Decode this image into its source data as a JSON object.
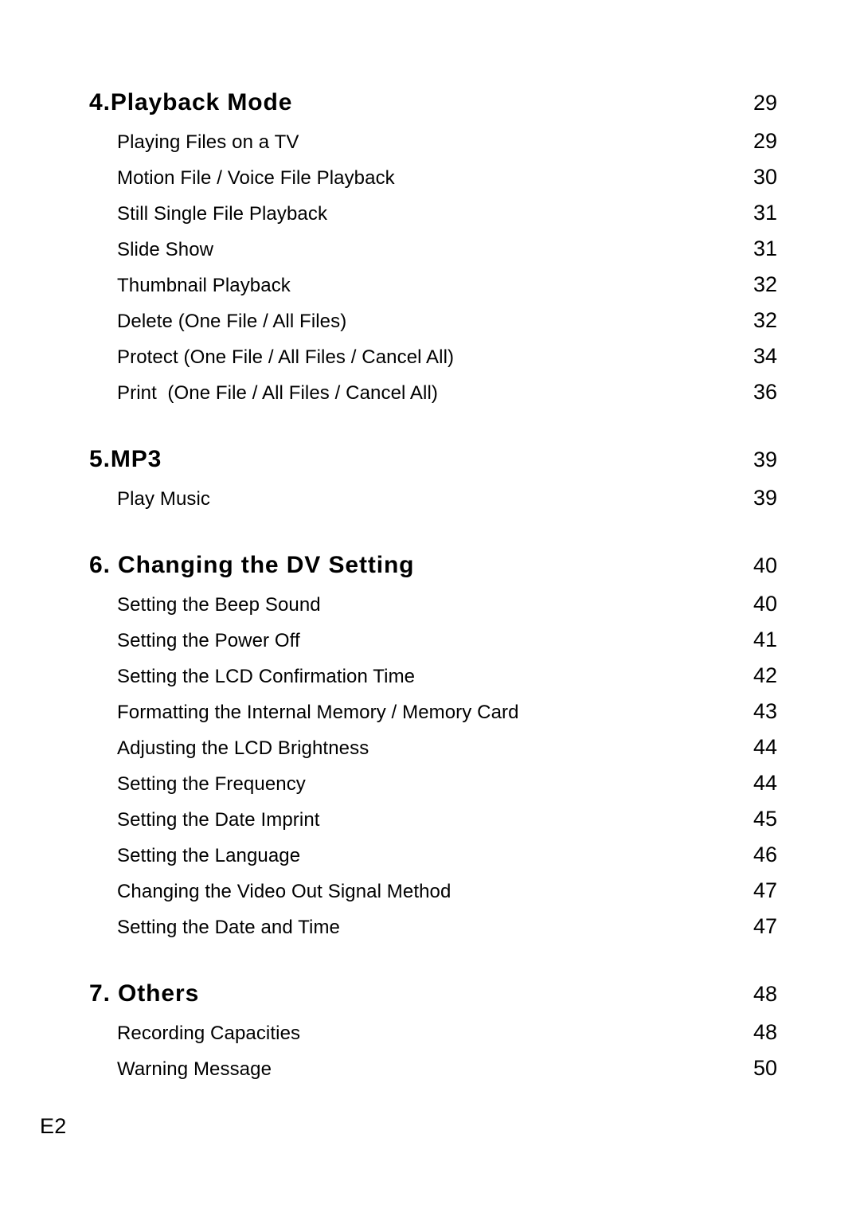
{
  "document": {
    "type": "table-of-contents",
    "footer_label": "E2",
    "page_number_column_label": ""
  },
  "sections": [
    {
      "heading": "4.Playback Mode",
      "heading_page": "29",
      "entries": [
        {
          "title": "Playing Files on a TV",
          "page": "29"
        },
        {
          "title": "Motion File / Voice File Playback",
          "page": "30"
        },
        {
          "title": "Still Single File Playback",
          "page": "31"
        },
        {
          "title": "Slide Show",
          "page": "31"
        },
        {
          "title": "Thumbnail Playback",
          "page": "32"
        },
        {
          "title": "Delete (One File / All Files)",
          "page": "32"
        },
        {
          "title": "Protect (One File / All Files / Cancel All)",
          "page": "34"
        },
        {
          "title": "Print  (One File / All Files / Cancel All)",
          "page": "36"
        }
      ]
    },
    {
      "heading": "5.MP3",
      "heading_page": "39",
      "entries": [
        {
          "title": "Play Music",
          "page": "39"
        }
      ]
    },
    {
      "heading": "6. Changing the DV Setting",
      "heading_page": "40",
      "entries": [
        {
          "title": "Setting the Beep Sound",
          "page": "40"
        },
        {
          "title": "Setting the Power Off",
          "page": "41"
        },
        {
          "title": "Setting the LCD Confirmation Time",
          "page": "42"
        },
        {
          "title": "Formatting the Internal Memory / Memory Card",
          "page": "43"
        },
        {
          "title": "Adjusting the LCD Brightness",
          "page": "44"
        },
        {
          "title": "Setting the Frequency",
          "page": "44"
        },
        {
          "title": "Setting the Date Imprint",
          "page": "45"
        },
        {
          "title": "Setting the Language",
          "page": "46"
        },
        {
          "title": "Changing the Video Out Signal Method",
          "page": "47"
        },
        {
          "title": "Setting the Date and Time",
          "page": "47"
        }
      ]
    },
    {
      "heading": "7. Others",
      "heading_page": "48",
      "entries": [
        {
          "title": "Recording Capacities",
          "page": "48"
        },
        {
          "title": "Warning Message",
          "page": "50"
        }
      ]
    }
  ]
}
